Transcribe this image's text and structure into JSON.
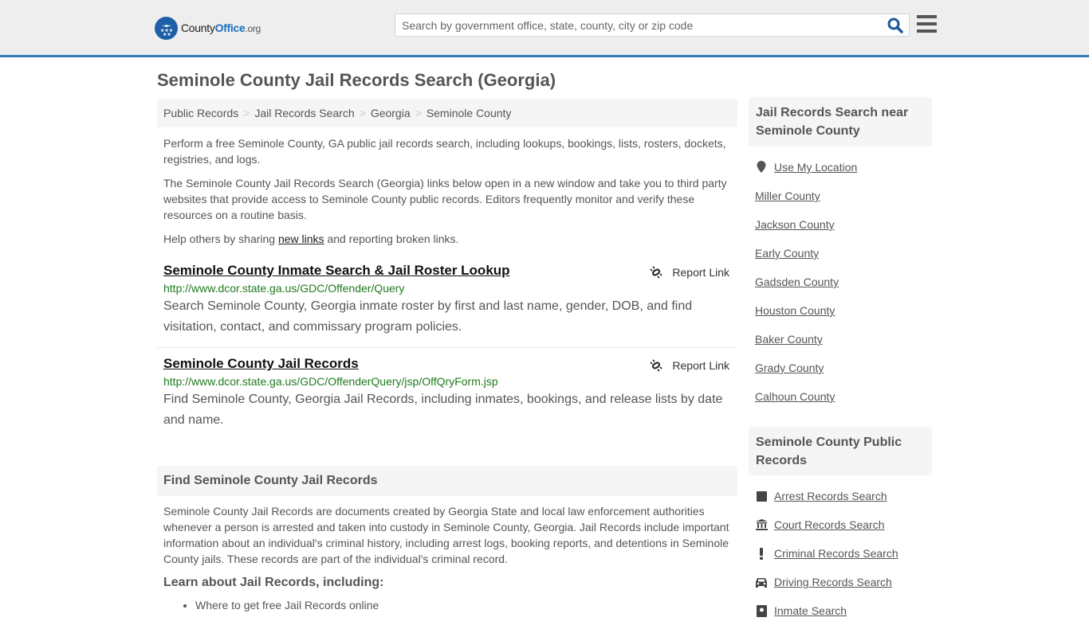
{
  "header": {
    "logo": {
      "county": "County",
      "office": "Office",
      "org": ".org"
    },
    "search": {
      "placeholder": "Search by government office, state, county, city or zip code",
      "value": ""
    },
    "icons": {
      "search": "search-icon",
      "menu": "hamburger-menu-icon"
    }
  },
  "page": {
    "title": "Seminole County Jail Records Search (Georgia)"
  },
  "breadcrumb": {
    "items": [
      "Public Records",
      "Jail Records Search",
      "Georgia",
      "Seminole County"
    ],
    "separator": ">"
  },
  "intro": {
    "p1": "Perform a free Seminole County, GA public jail records search, including lookups, bookings, lists, rosters, dockets, registries, and logs.",
    "p2": "The Seminole County Jail Records Search (Georgia) links below open in a new window and take you to third party websites that provide access to Seminole County public records. Editors frequently monitor and verify these resources on a routine basis.",
    "p3_before": "Help others by sharing ",
    "p3_link": "new links",
    "p3_after": " and reporting broken links."
  },
  "results": [
    {
      "title": "Seminole County Inmate Search & Jail Roster Lookup",
      "url": "http://www.dcor.state.ga.us/GDC/Offender/Query",
      "description": "Search Seminole County, Georgia inmate roster by first and last name, gender, DOB, and find visitation, contact, and commissary program policies.",
      "report_label": "Report Link"
    },
    {
      "title": "Seminole County Jail Records",
      "url": "http://www.dcor.state.ga.us/GDC/OffenderQuery/jsp/OffQryForm.jsp",
      "description": "Find Seminole County, Georgia Jail Records, including inmates, bookings, and release lists by date and name.",
      "report_label": "Report Link"
    }
  ],
  "find_section": {
    "heading": "Find Seminole County Jail Records",
    "body": "Seminole County Jail Records are documents created by Georgia State and local law enforcement authorities whenever a person is arrested and taken into custody in Seminole County, Georgia. Jail Records include important information about an individual's criminal history, including arrest logs, booking reports, and detentions in Seminole County jails. These records are part of the individual's criminal record.",
    "learn_heading": "Learn about Jail Records, including:",
    "learn_items": [
      "Where to get free Jail Records online"
    ]
  },
  "sidebar": {
    "nearby": {
      "heading": "Jail Records Search near Seminole County",
      "use_location": "Use My Location",
      "counties": [
        "Miller County",
        "Jackson County",
        "Early County",
        "Gadsden County",
        "Houston County",
        "Baker County",
        "Grady County",
        "Calhoun County"
      ]
    },
    "public_records": {
      "heading": "Seminole County Public Records",
      "items": [
        {
          "label": "Arrest Records Search",
          "icon": "square-icon"
        },
        {
          "label": "Court Records Search",
          "icon": "courthouse-icon"
        },
        {
          "label": "Criminal Records Search",
          "icon": "exclamation-icon"
        },
        {
          "label": "Driving Records Search",
          "icon": "car-icon"
        },
        {
          "label": "Inmate Search",
          "icon": "inmate-icon"
        }
      ]
    }
  },
  "colors": {
    "accent": "#337ab7",
    "link_green": "#1f7a1f",
    "logo_blue": "#1e5fa8",
    "text": "#555555"
  }
}
